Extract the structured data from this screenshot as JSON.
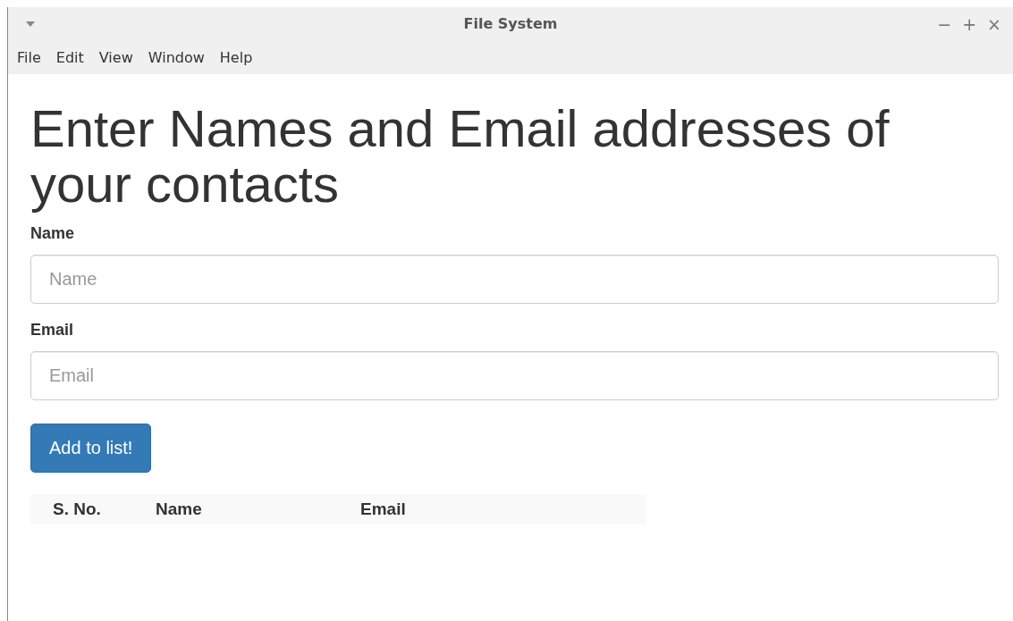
{
  "window": {
    "title": "File System",
    "controls": [
      "−",
      "+",
      "×"
    ]
  },
  "menu": [
    "File",
    "Edit",
    "View",
    "Window",
    "Help"
  ],
  "heading": "Enter Names and Email addresses of your contacts",
  "fields": [
    {
      "label": "Name",
      "placeholder": "Name"
    },
    {
      "label": "Email",
      "placeholder": "Email"
    }
  ],
  "button": "Add to list!",
  "table": {
    "columns": [
      "S. No.",
      "Name",
      "Email"
    ]
  }
}
